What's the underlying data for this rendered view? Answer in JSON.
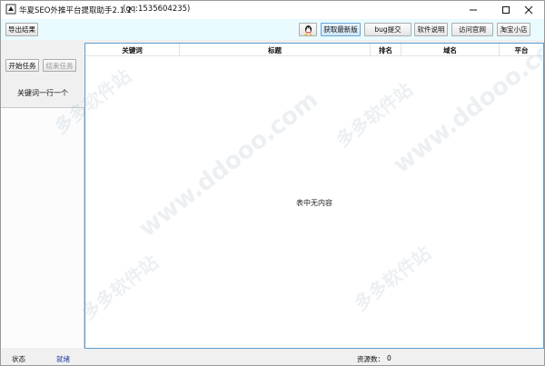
{
  "window": {
    "title": "华夏SEO外推平台提取助手2.1.2",
    "qq": "(qq:1535604235)"
  },
  "toolbar": {
    "export_label": "导出结果",
    "latest_label": "获取最新版",
    "bug_label": "bug提交",
    "manual_label": "软件说明",
    "website_label": "访问官网",
    "shop_label": "淘宝小店"
  },
  "left_panel": {
    "start_label": "开始任务",
    "stop_label": "结束任务",
    "hint": "关键词一行一个"
  },
  "table": {
    "columns": [
      "关键词",
      "标题",
      "排名",
      "域名",
      "平台"
    ],
    "empty_text": "表中无内容"
  },
  "statusbar": {
    "status_label": "状态",
    "status_value": "就绪",
    "resource_label": "资源数：",
    "resource_value": "0"
  },
  "watermark": {
    "text_cn": "多多软件站",
    "text_en": "www.ddooo.com"
  },
  "colors": {
    "accent": "#5c9ccc",
    "toolbar_bg": "#e9fbff",
    "status_value": "#1f3f9f"
  },
  "icons": {
    "app": "app-icon",
    "qq": "qq-penguin-icon",
    "minimize": "minimize-icon",
    "maximize": "maximize-icon",
    "close": "close-icon"
  }
}
